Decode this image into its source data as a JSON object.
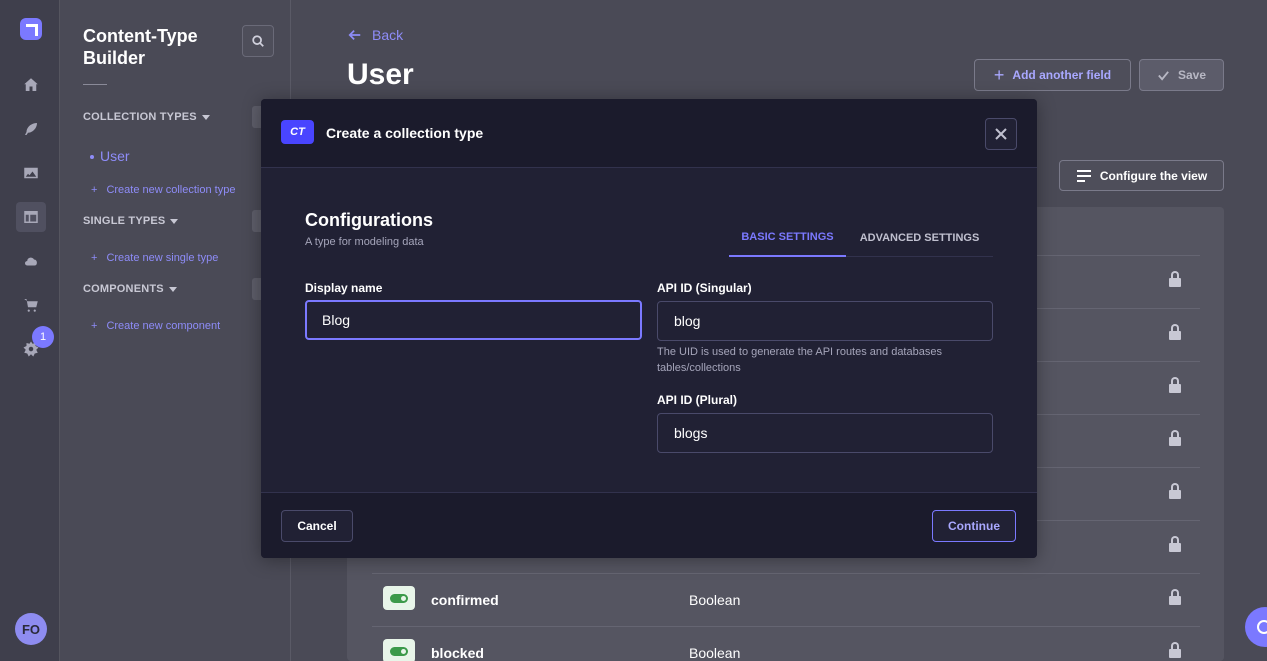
{
  "rail": {
    "icons": [
      "strapi-logo-icon",
      "home-icon",
      "feather-icon",
      "image-icon",
      "layout-icon",
      "cloud-icon",
      "cart-icon",
      "gear-icon"
    ],
    "settings_badge": "1",
    "avatar_initials": "FO"
  },
  "sidebar": {
    "title": "Content-Type Builder",
    "sections": {
      "collection_types": "COLLECTION TYPES",
      "single_types": "SINGLE TYPES",
      "components": "COMPONENTS"
    },
    "collection_items": [
      "User"
    ],
    "links": {
      "create_collection": "Create new collection type",
      "create_single": "Create new single type",
      "create_component": "Create new component"
    },
    "plus": "+"
  },
  "main": {
    "back_label": "Back",
    "title": "User",
    "add_field_label": "Add another field",
    "save_label": "Save",
    "configure_label": "Configure the view",
    "fields": [
      {
        "name": "confirmed",
        "type": "Boolean"
      },
      {
        "name": "blocked",
        "type": "Boolean"
      }
    ]
  },
  "modal": {
    "badge": "CT",
    "title": "Create a collection type",
    "heading": "Configurations",
    "subheading": "A type for modeling data",
    "tabs": [
      "BASIC SETTINGS",
      "ADVANCED SETTINGS"
    ],
    "active_tab": "BASIC SETTINGS",
    "display_name": {
      "label": "Display name",
      "value": "Blog"
    },
    "api_singular": {
      "label": "API ID (Singular)",
      "value": "blog"
    },
    "api_hint": "The UID is used to generate the API routes and databases tables/collections",
    "api_plural": {
      "label": "API ID (Plural)",
      "value": "blogs"
    },
    "cancel_label": "Cancel",
    "continue_label": "Continue"
  },
  "colors": {
    "accent": "#7b79ff",
    "modal_bg": "#212134",
    "overlay_bg": "#4a4a56"
  }
}
